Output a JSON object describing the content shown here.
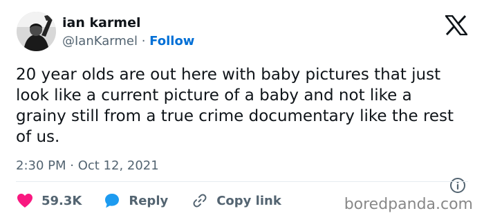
{
  "author": {
    "display_name": "ian karmel",
    "handle": "@IanKarmel",
    "separator": "·",
    "follow_label": "Follow"
  },
  "tweet": {
    "text": "20 year olds are out here with baby pictures that just look like a current picture of a baby and not like a grainy still from a true crime documentary like the rest of us.",
    "timestamp": "2:30 PM · Oct 12, 2021"
  },
  "actions": {
    "like_count": "59.3K",
    "reply_label": "Reply",
    "copy_link_label": "Copy link"
  },
  "watermark": "boredpanda.com",
  "colors": {
    "link_blue": "#006fd6",
    "like_pink": "#f91880",
    "reply_blue": "#1d9bf0",
    "text_dark": "#0f1419",
    "text_gray": "#536471"
  },
  "icons": {
    "brand": "x-logo-icon",
    "info": "info-icon",
    "like": "heart-icon",
    "reply": "speech-bubble-icon",
    "copy_link": "link-icon"
  }
}
